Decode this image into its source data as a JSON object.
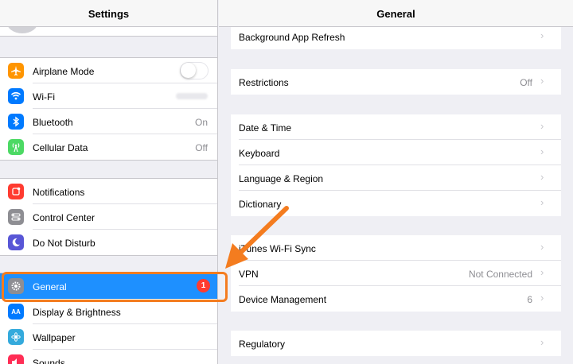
{
  "left_panel": {
    "title": "Settings",
    "groups": [
      [
        {
          "label": "Airplane Mode",
          "icon": "airplane-icon",
          "color": "#ff9500",
          "control": "toggle"
        },
        {
          "label": "Wi-Fi",
          "icon": "wifi-icon",
          "color": "#007aff",
          "value": ""
        },
        {
          "label": "Bluetooth",
          "icon": "bluetooth-icon",
          "color": "#007aff",
          "value": "On"
        },
        {
          "label": "Cellular Data",
          "icon": "cellular-icon",
          "color": "#4cd964",
          "value": "Off"
        }
      ],
      [
        {
          "label": "Notifications",
          "icon": "notifications-icon",
          "color": "#ff3b30"
        },
        {
          "label": "Control Center",
          "icon": "control-center-icon",
          "color": "#8e8e93"
        },
        {
          "label": "Do Not Disturb",
          "icon": "moon-icon",
          "color": "#5856d6"
        }
      ],
      [
        {
          "label": "General",
          "icon": "gear-icon",
          "color": "#8e8e93",
          "badge": "1",
          "selected": true
        },
        {
          "label": "Display & Brightness",
          "icon": "display-icon",
          "color": "#007aff"
        },
        {
          "label": "Wallpaper",
          "icon": "wallpaper-icon",
          "color": "#34aadc"
        },
        {
          "label": "Sounds",
          "icon": "sounds-icon",
          "color": "#ff2d55"
        }
      ]
    ]
  },
  "right_panel": {
    "title": "General",
    "groups": [
      [
        {
          "label": "Background App Refresh"
        }
      ],
      [
        {
          "label": "Restrictions",
          "value": "Off"
        }
      ],
      [
        {
          "label": "Date & Time"
        },
        {
          "label": "Keyboard"
        },
        {
          "label": "Language & Region"
        },
        {
          "label": "Dictionary"
        }
      ],
      [
        {
          "label": "iTunes Wi-Fi Sync"
        },
        {
          "label": "VPN",
          "value": "Not Connected"
        },
        {
          "label": "Device Management",
          "value": "6"
        }
      ],
      [
        {
          "label": "Regulatory"
        }
      ]
    ]
  },
  "colors": {
    "accent": "#1e90ff",
    "highlight": "#f47c1f"
  }
}
